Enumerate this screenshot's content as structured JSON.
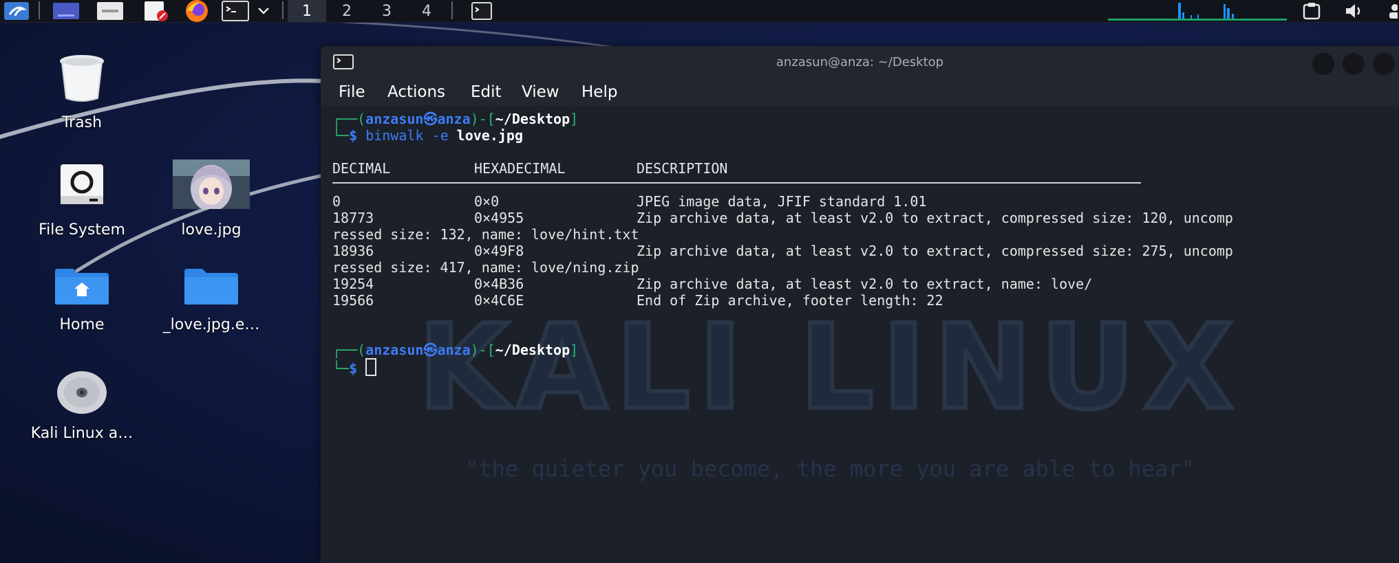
{
  "panel": {
    "workspaces": [
      "1",
      "2",
      "3",
      "4"
    ],
    "active_workspace": "1"
  },
  "desktop": {
    "icons": [
      {
        "label": "Trash",
        "icon": "trash-icon"
      },
      {
        "label": "File System",
        "icon": "drive-icon"
      },
      {
        "label": "love.jpg",
        "icon": "image-thumbnail"
      },
      {
        "label": "Home",
        "icon": "home-folder-icon"
      },
      {
        "label": "_love.jpg.e…",
        "icon": "folder-icon"
      },
      {
        "label": "Kali Linux a…",
        "icon": "disc-icon"
      }
    ],
    "watermark_title": "KALI LINUX",
    "watermark_tagline": "\"the quieter you become, the more you are able to hear\""
  },
  "terminal": {
    "title": "anzasun@anza: ~/Desktop",
    "menu": [
      "File",
      "Actions",
      "Edit",
      "View",
      "Help"
    ],
    "prompt": {
      "user": "anzasun",
      "at": "㉿",
      "host": "anza",
      "dir": "~/Desktop",
      "dollar": "$"
    },
    "command": {
      "cmd": "binwalk",
      "flag": "-e",
      "arg": "love.jpg"
    },
    "table": {
      "headers": [
        "DECIMAL",
        "HEXADECIMAL",
        "DESCRIPTION"
      ],
      "rows": [
        {
          "decimal": "0",
          "hex": "0×0",
          "desc": "JPEG image data, JFIF standard 1.01"
        },
        {
          "decimal": "18773",
          "hex": "0×4955",
          "desc": "Zip archive data, at least v2.0 to extract, compressed size: 120, uncomp"
        },
        {
          "wrap": "ressed size: 132, name: love/hint.txt"
        },
        {
          "decimal": "18936",
          "hex": "0×49F8",
          "desc": "Zip archive data, at least v2.0 to extract, compressed size: 275, uncomp"
        },
        {
          "wrap": "ressed size: 417, name: love/ning.zip"
        },
        {
          "decimal": "19254",
          "hex": "0×4B36",
          "desc": "Zip archive data, at least v2.0 to extract, name: love/"
        },
        {
          "decimal": "19566",
          "hex": "0×4C6E",
          "desc": "End of Zip archive, footer length: 22"
        }
      ]
    }
  },
  "colors": {
    "prompt_blue": "#3d7cf5",
    "prompt_green": "#2bb673",
    "terminal_bg": "#1c2029",
    "panel_bg": "#11141b"
  }
}
